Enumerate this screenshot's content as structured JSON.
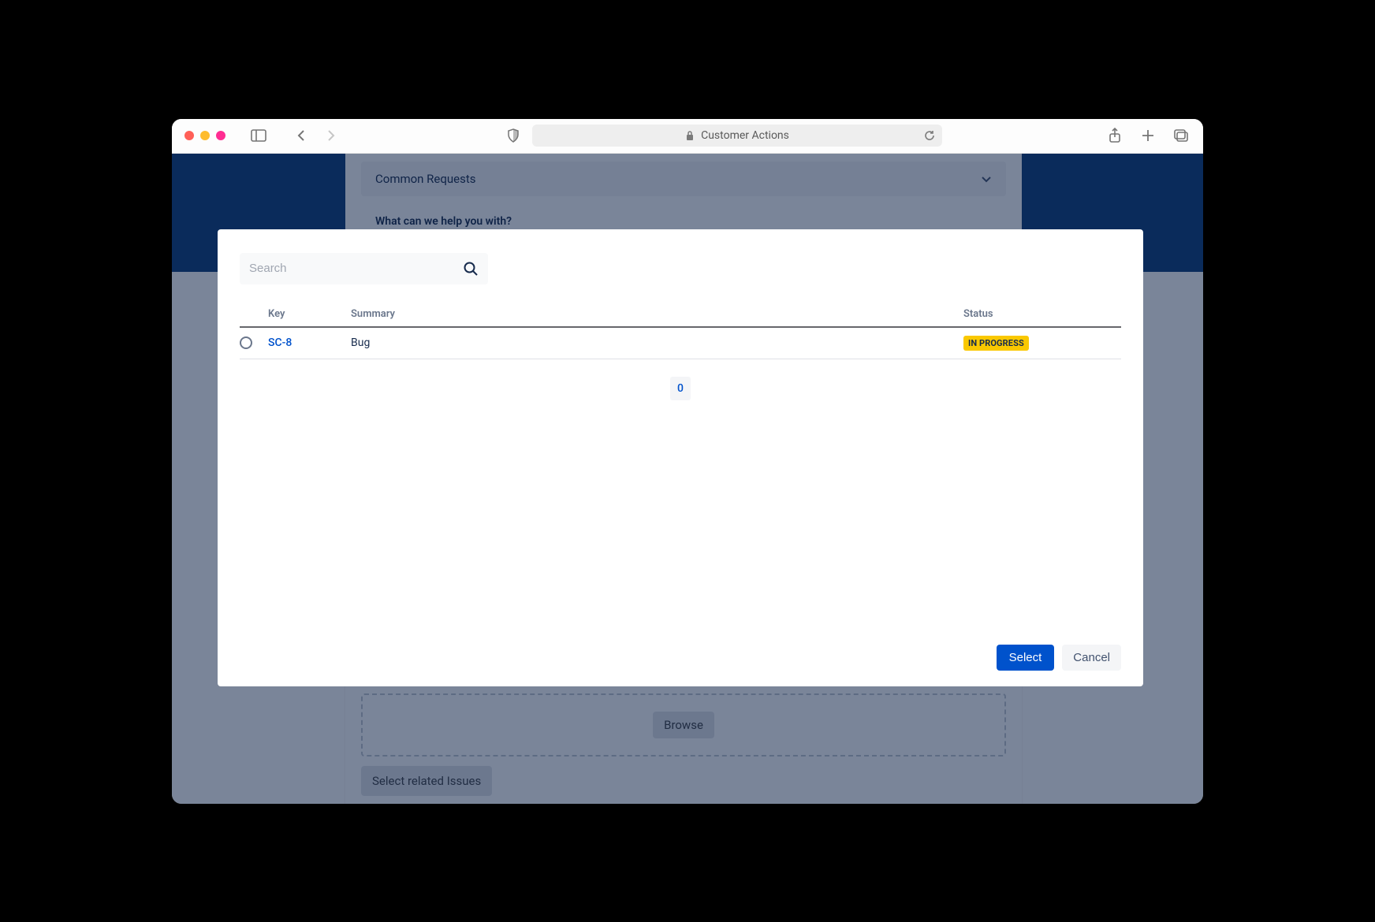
{
  "browser": {
    "page_title": "Customer Actions"
  },
  "background": {
    "accordion_label": "Common Requests",
    "help_question": "What can we help you with?",
    "browse_label": "Browse",
    "select_related_label": "Select related Issues"
  },
  "modal": {
    "search": {
      "placeholder": "Search",
      "value": ""
    },
    "columns": {
      "key": "Key",
      "summary": "Summary",
      "status": "Status"
    },
    "rows": [
      {
        "key": "SC-8",
        "summary": "Bug",
        "status": "IN PROGRESS",
        "status_color": "#fac800",
        "selected": false
      }
    ],
    "pager": {
      "current": "0"
    },
    "buttons": {
      "select": "Select",
      "cancel": "Cancel"
    }
  }
}
